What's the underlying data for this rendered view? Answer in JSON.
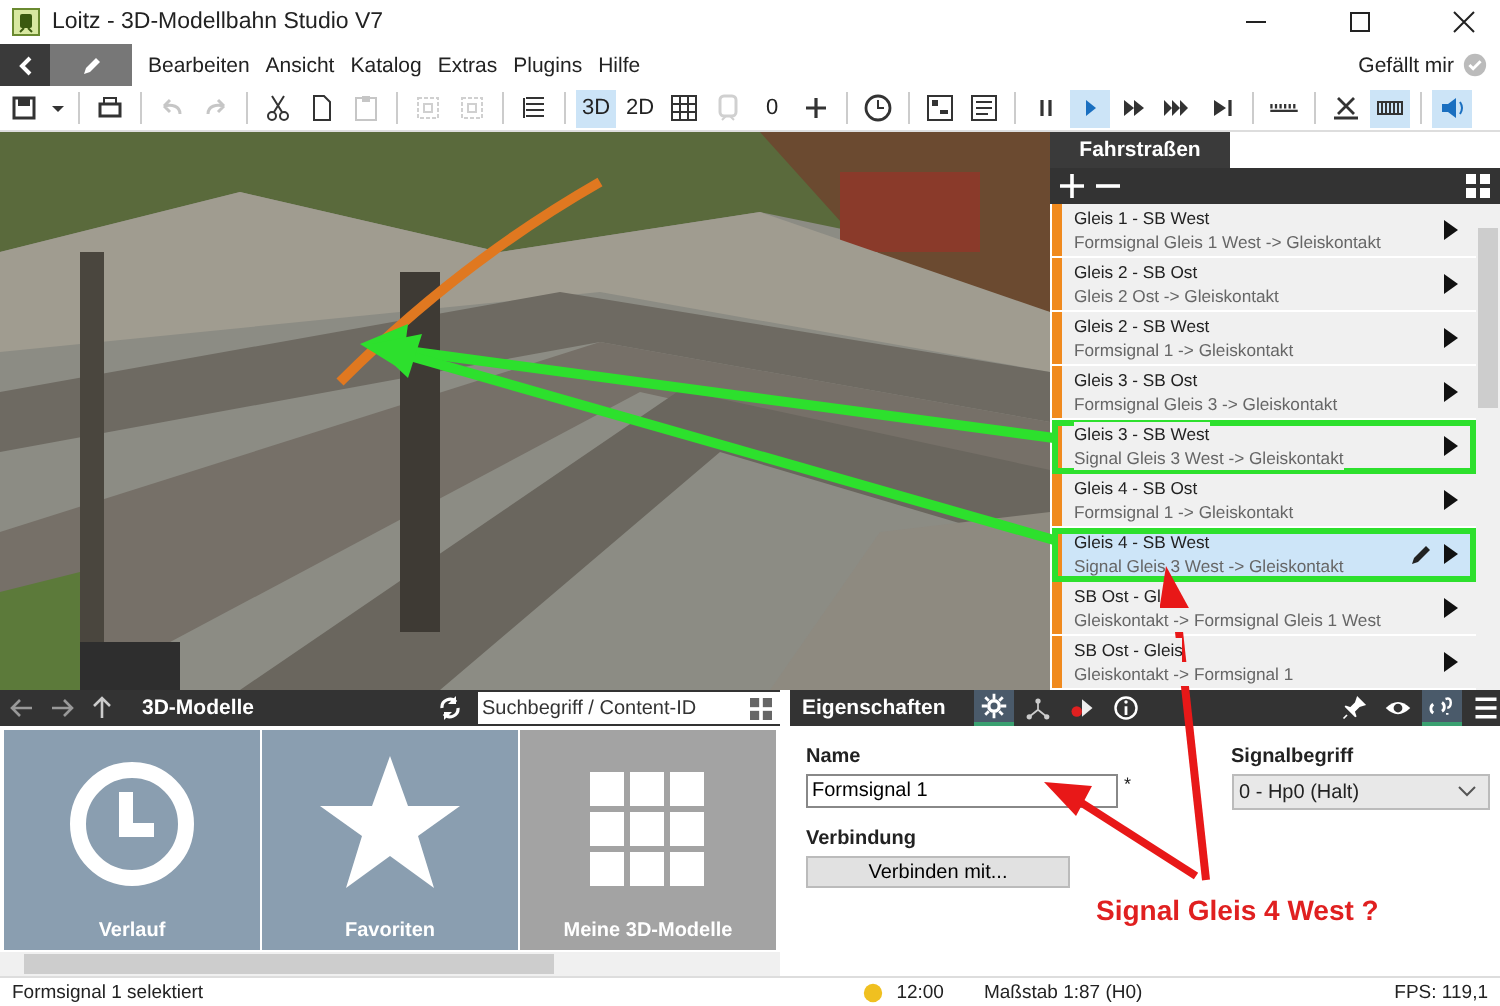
{
  "window": {
    "title": "Loitz - 3D-Modellbahn Studio V7"
  },
  "menu": {
    "items": [
      "Bearbeiten",
      "Ansicht",
      "Katalog",
      "Extras",
      "Plugins",
      "Hilfe"
    ],
    "like": "Gefällt mir"
  },
  "toolbar": [
    [
      {
        "kind": "icon",
        "pressed": false,
        "disabled": false
      },
      {
        "kind": "icon",
        "pressed": false,
        "disabled": false
      }
    ],
    [
      {
        "kind": "icon",
        "pressed": false,
        "disabled": false
      }
    ],
    [
      {
        "kind": "icon",
        "pressed": false,
        "disabled": true
      },
      {
        "kind": "icon",
        "pressed": false,
        "disabled": true
      }
    ],
    [
      {
        "kind": "icon",
        "pressed": false,
        "disabled": false
      },
      {
        "kind": "icon",
        "pressed": false,
        "disabled": false
      },
      {
        "kind": "icon",
        "pressed": false,
        "disabled": true
      }
    ],
    [
      {
        "kind": "icon",
        "pressed": false,
        "disabled": true
      },
      {
        "kind": "icon",
        "pressed": false,
        "disabled": true
      }
    ],
    [
      {
        "kind": "icon",
        "pressed": false,
        "disabled": false
      }
    ],
    [
      {
        "kind": "text",
        "label": "3D",
        "pressed": true,
        "disabled": false
      },
      {
        "kind": "text",
        "label": "2D",
        "pressed": false,
        "disabled": false
      },
      {
        "kind": "icon",
        "pressed": false,
        "disabled": false
      },
      {
        "kind": "icon",
        "pressed": false,
        "disabled": true
      },
      {
        "kind": "text",
        "label": "0",
        "pressed": false,
        "disabled": false
      },
      {
        "kind": "icon",
        "pressed": false,
        "disabled": false
      }
    ],
    [
      {
        "kind": "icon",
        "pressed": false,
        "disabled": false
      }
    ],
    [
      {
        "kind": "icon",
        "pressed": false,
        "disabled": false
      },
      {
        "kind": "icon",
        "pressed": false,
        "disabled": false
      }
    ],
    [
      {
        "kind": "icon",
        "pressed": false,
        "disabled": false
      },
      {
        "kind": "icon",
        "pressed": true,
        "disabled": false
      },
      {
        "kind": "icon",
        "pressed": false,
        "disabled": false
      },
      {
        "kind": "icon",
        "pressed": false,
        "disabled": false
      },
      {
        "kind": "icon",
        "pressed": false,
        "disabled": false
      }
    ],
    [
      {
        "kind": "icon",
        "pressed": false,
        "disabled": false
      }
    ],
    [
      {
        "kind": "icon",
        "pressed": false,
        "disabled": false
      },
      {
        "kind": "icon",
        "pressed": true,
        "disabled": false
      }
    ],
    [
      {
        "kind": "icon",
        "pressed": true,
        "disabled": false
      }
    ]
  ],
  "routes_panel": {
    "tab": "Fahrstraßen",
    "routes": [
      {
        "title": "Gleis 1 - SB West",
        "subtitle": "Formsignal Gleis 1 West -> Gleiskontakt",
        "selected": false,
        "highlighted": false
      },
      {
        "title": "Gleis 2 - SB Ost",
        "subtitle": "Gleis 2 Ost -> Gleiskontakt",
        "selected": false,
        "highlighted": false
      },
      {
        "title": "Gleis 2 - SB West",
        "subtitle": "Formsignal 1 -> Gleiskontakt",
        "selected": false,
        "highlighted": false
      },
      {
        "title": "Gleis 3 - SB Ost",
        "subtitle": "Formsignal Gleis 3 -> Gleiskontakt",
        "selected": false,
        "highlighted": false
      },
      {
        "title": "Gleis 3 - SB West",
        "subtitle": "Signal Gleis 3 West -> Gleiskontakt",
        "selected": false,
        "highlighted": true
      },
      {
        "title": "Gleis 4 - SB Ost",
        "subtitle": "Formsignal 1 -> Gleiskontakt",
        "selected": false,
        "highlighted": false
      },
      {
        "title": "Gleis 4 - SB West",
        "subtitle": "Signal Gleis 3 West -> Gleiskontakt",
        "selected": true,
        "highlighted": true
      },
      {
        "title": "SB Ost - Gl",
        "subtitle": "Gleiskontakt -> Formsignal Gleis 1 West",
        "selected": false,
        "highlighted": false
      },
      {
        "title": "SB Ost - Gleis",
        "subtitle": "Gleiskontakt -> Formsignal 1",
        "selected": false,
        "highlighted": false
      }
    ]
  },
  "catalog": {
    "title": "3D-Modelle",
    "search": {
      "placeholder": "Suchbegriff / Content-ID"
    },
    "tiles": [
      {
        "label": "Verlauf",
        "kind": "clock"
      },
      {
        "label": "Favoriten",
        "kind": "star"
      },
      {
        "label": "Meine 3D-Modelle",
        "kind": "grid"
      }
    ]
  },
  "properties": {
    "title": "Eigenschaften",
    "tabs": [
      {
        "selected": true
      },
      {
        "selected": false
      },
      {
        "selected": false
      },
      {
        "selected": false
      }
    ],
    "right_tools": [
      {
        "selected": false
      },
      {
        "selected": false
      },
      {
        "selected": true
      },
      {
        "selected": false
      }
    ],
    "name_label": "Name",
    "name_value": "Formsignal 1",
    "required_mark": "*",
    "signal_label": "Signalbegriff",
    "signal_value": "0 - Hp0 (Halt)",
    "connection_label": "Verbindung",
    "connect_button": "Verbinden mit..."
  },
  "annotation": {
    "text": "Signal Gleis 4 West ?"
  },
  "status_bar": {
    "message": "Formsignal 1 selektiert",
    "time": "12:00",
    "scale": "Maßstab 1:87 (H0)",
    "fps": "FPS: 119,1"
  }
}
